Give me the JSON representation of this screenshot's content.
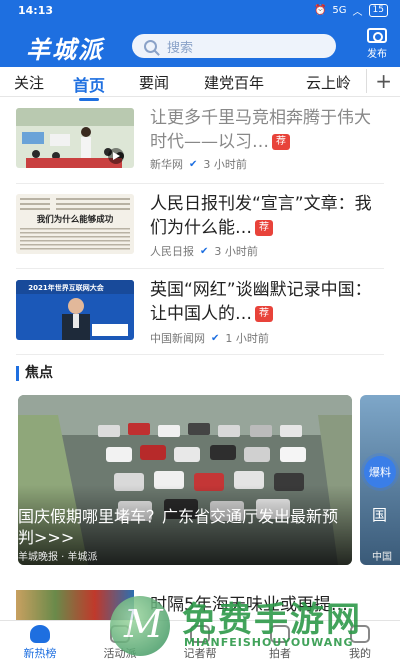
{
  "status_bar": {
    "time": "14:13",
    "signal": "5G",
    "battery": "15"
  },
  "header": {
    "logo": "羊城派",
    "search_placeholder": "搜索",
    "publish_label": "发布"
  },
  "tabs": [
    {
      "label": "关注"
    },
    {
      "label": "首页",
      "active": true
    },
    {
      "label": "要闻"
    },
    {
      "label": "建党百年"
    },
    {
      "label": "云上岭"
    }
  ],
  "tabs_plus": "+",
  "news": [
    {
      "headline": "让更多千里马竞相奔腾于伟大时代——以习…",
      "badge": "荐",
      "source": "新华网",
      "time": "3 小时前"
    },
    {
      "headline": "人民日报刊发“宣言”文章：我们为什么能…",
      "badge": "荐",
      "source": "人民日报",
      "time": "3 小时前"
    },
    {
      "headline": "英国“网红”谈幽默记录中国：让中国人的…",
      "badge": "荐",
      "source": "中国新闻网",
      "time": "1 小时前"
    }
  ],
  "thumb_texts": {
    "newspaper_heading": "我们为什么能够成功",
    "conference_banner": "2021年世界互联网大会"
  },
  "focus": {
    "section_title": "焦点",
    "card_headline": "国庆假期哪里堵车？广东省交通厅发出最新预判>>>",
    "card_source": "羊城晚报 · 羊城派",
    "side_headline": "国",
    "side_source": "中国",
    "baoliao": "爆料"
  },
  "next_item": {
    "headline": "时隔5年海天味业或再提…"
  },
  "bottom_nav": [
    {
      "label": "新热榜",
      "active": true
    },
    {
      "label": "活动派"
    },
    {
      "label": "记者帮"
    },
    {
      "label": "拍者"
    },
    {
      "label": "我的"
    }
  ],
  "watermark": {
    "glyph": "M",
    "cn": "免费手游网",
    "en": "MIANFEISHOUYOUWANG"
  },
  "colors": {
    "brand_blue": "#1e6fe0",
    "badge_red": "#e8433a"
  }
}
